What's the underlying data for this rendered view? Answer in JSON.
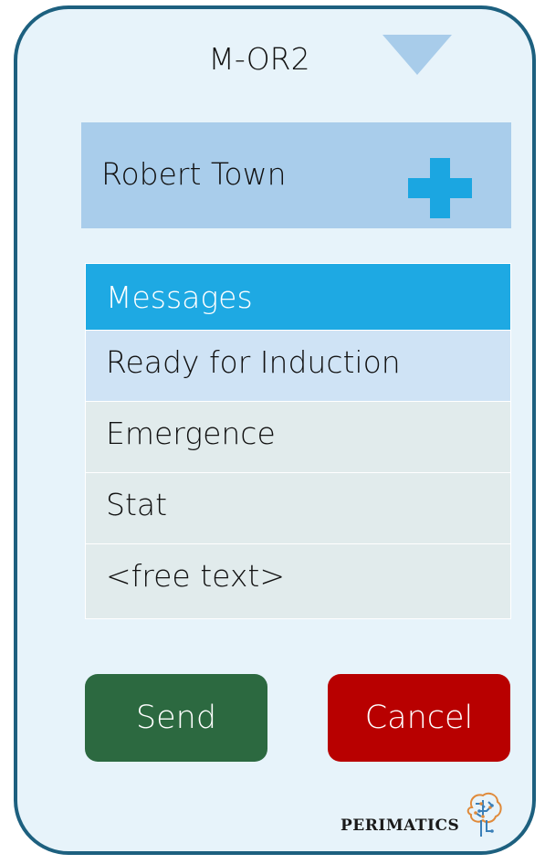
{
  "station": {
    "label": "M-OR2",
    "dropdown_icon": "triangle-down-icon"
  },
  "patient": {
    "name": "Robert Town",
    "add_icon": "plus-icon",
    "accent": "#1ba6e1"
  },
  "messages": {
    "header": "Messages",
    "items": [
      {
        "label": "Ready for Induction",
        "selected": true
      },
      {
        "label": "Emergence",
        "selected": false
      },
      {
        "label": "Stat",
        "selected": false
      },
      {
        "label": "<free text>",
        "selected": false
      }
    ]
  },
  "actions": {
    "send_label": "Send",
    "send_color": "#2c6940",
    "cancel_label": "Cancel",
    "cancel_color": "#b80000"
  },
  "brand": {
    "name": "PERIMATICS",
    "logo_icon": "brain-circuit-icon"
  },
  "colors": {
    "frame_border": "#1d607f",
    "frame_background": "#e7f3fa"
  }
}
